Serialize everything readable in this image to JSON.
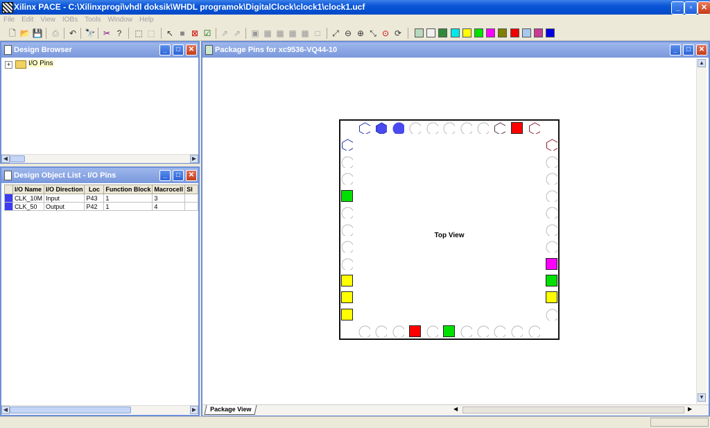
{
  "window": {
    "title": "Xilinx PACE - C:\\Xilinxprogi\\vhdl doksik\\WHDL programok\\DigitalClock\\clock1\\clock1.ucf"
  },
  "menu": [
    "File",
    "Edit",
    "View",
    "IOBs",
    "Tools",
    "Window",
    "Help"
  ],
  "toolbar_colors": [
    "#b8d8c0",
    "#f0f0f0",
    "#2e8b3c",
    "#00e8e8",
    "#ffff00",
    "#00e000",
    "#ff00ff",
    "#808000",
    "#ee0000",
    "#a8c8f0",
    "#c83c96",
    "#0000e0"
  ],
  "design_browser": {
    "title": "Design Browser",
    "tree_root": "I/O Pins"
  },
  "object_list": {
    "title": "Design Object List - I/O Pins",
    "columns": [
      "I/O Name",
      "I/O Direction",
      "Loc",
      "Function Block",
      "Macrocell",
      "Sl"
    ],
    "rows": [
      {
        "name": "CLK_10M",
        "direction": "Input",
        "loc": "P43",
        "fb": "1",
        "mc": "3",
        "color": "#3c3cf0"
      },
      {
        "name": "CLK_50",
        "direction": "Output",
        "loc": "P42",
        "fb": "1",
        "mc": "4",
        "color": "#3c3cf0"
      }
    ]
  },
  "package": {
    "title": "Package Pins for xc9536-VQ44-10",
    "view_label": "Top View",
    "tab_label": "Package View"
  }
}
